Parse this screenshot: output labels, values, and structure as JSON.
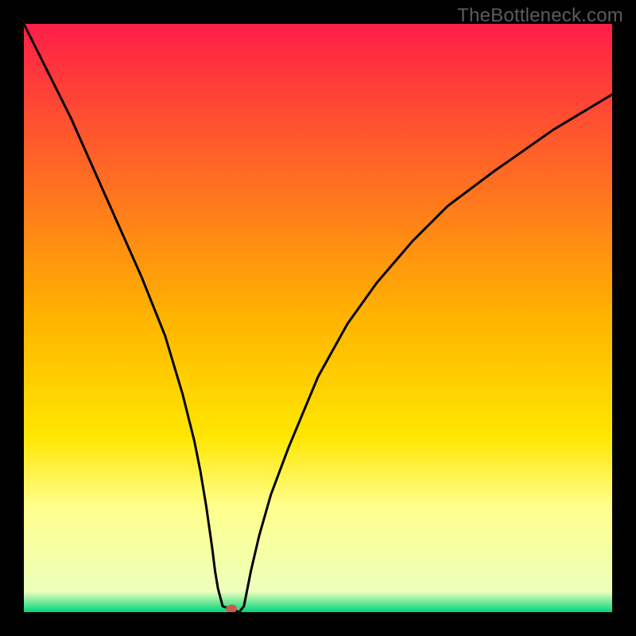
{
  "watermark": "TheBottleneck.com",
  "chart_data": {
    "type": "line",
    "title": "",
    "xlabel": "",
    "ylabel": "",
    "xlim": [
      0,
      100
    ],
    "ylim": [
      0,
      100
    ],
    "gradient_stops": [
      {
        "offset": 0.0,
        "color": "#ff1e48"
      },
      {
        "offset": 0.5,
        "color": "#ffb400"
      },
      {
        "offset": 0.7,
        "color": "#ffe600"
      },
      {
        "offset": 0.82,
        "color": "#ffff8c"
      },
      {
        "offset": 0.965,
        "color": "#ecffbb"
      },
      {
        "offset": 1.0,
        "color": "#00d47a"
      }
    ],
    "series": [
      {
        "name": "curve",
        "x": [
          0,
          4,
          8,
          12,
          16,
          20,
          24,
          27,
          29,
          30,
          31,
          32,
          32.5,
          33,
          33.8,
          36.6,
          37.4,
          38,
          38.6,
          40,
          42,
          45,
          50,
          55,
          60,
          66,
          72,
          80,
          90,
          100
        ],
        "y_pct": [
          100,
          92,
          84,
          75,
          66,
          57,
          47,
          37,
          29,
          24,
          18,
          11,
          7,
          4,
          1,
          0,
          1,
          4,
          7,
          13,
          20,
          28,
          40,
          49,
          56,
          63,
          69,
          75,
          82,
          88
        ]
      }
    ],
    "flat_segment": {
      "x0": 33.8,
      "x1": 36.6,
      "y_pct": 0
    },
    "marker": {
      "x": 35.3,
      "y_pct": 0.6,
      "rx": 7,
      "ry": 5,
      "color": "#c95b4e"
    }
  }
}
